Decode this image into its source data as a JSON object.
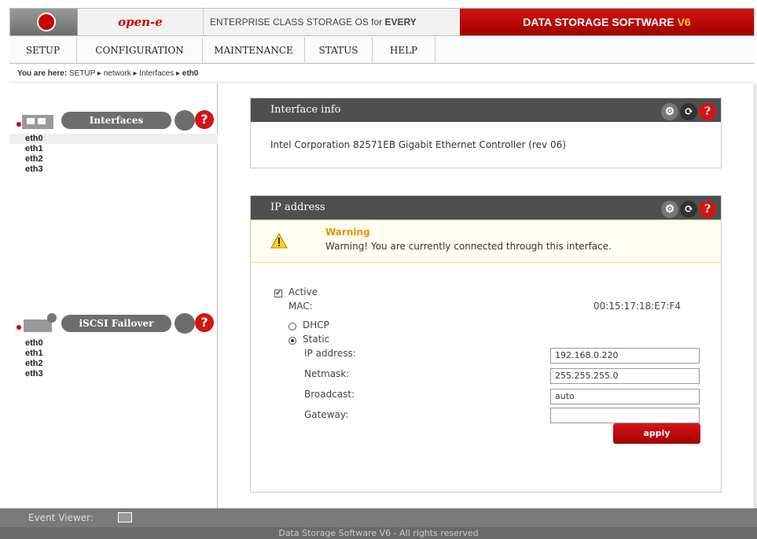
{
  "header": {
    "brand": "open-e",
    "tagline_prefix": "ENTERPRISE CLASS STORAGE OS for ",
    "tagline_bold": "EVERY BUSINESS",
    "product": "DATA STORAGE SOFTWARE ",
    "product_version": "V6"
  },
  "menu": [
    "SETUP",
    "CONFIGURATION",
    "MAINTENANCE",
    "STATUS",
    "HELP"
  ],
  "breadcrumb": {
    "prefix": "You are here:",
    "items": [
      "SETUP",
      "network",
      "Interfaces",
      "eth0"
    ]
  },
  "sidebar": {
    "interfaces": {
      "title": "Interfaces",
      "items": [
        "eth0",
        "eth1",
        "eth2",
        "eth3"
      ],
      "selected": "eth0"
    },
    "failover": {
      "title": "iSCSI Failover",
      "items": [
        "eth0",
        "eth1",
        "eth2",
        "eth3"
      ]
    },
    "help_glyph": "?"
  },
  "interface_info": {
    "title": "Interface info",
    "description": "Intel Corporation 82571EB Gigabit Ethernet Controller (rev 06)"
  },
  "ip_address": {
    "title": "IP address",
    "warning_title": "Warning",
    "warning_text": "Warning! You are currently connected through this interface.",
    "active_label": "Active",
    "active_checked": true,
    "mac_label": "MAC:",
    "mac_value": "00:15:17:18:E7:F4",
    "dhcp_label": "DHCP",
    "static_label": "Static",
    "mode": "static",
    "fields": {
      "ip_label": "IP address:",
      "ip_value": "192.168.0.220",
      "netmask_label": "Netmask:",
      "netmask_value": "255.255.255.0",
      "broadcast_label": "Broadcast:",
      "broadcast_value": "auto",
      "gateway_label": "Gateway:",
      "gateway_value": ""
    },
    "apply_label": "apply"
  },
  "event_viewer": "Event Viewer:",
  "footer": "Data Storage Software V6 - All rights reserved",
  "colors": {
    "accent": "#d21414",
    "dark": "#4f4f4f",
    "warn": "#e59400"
  }
}
